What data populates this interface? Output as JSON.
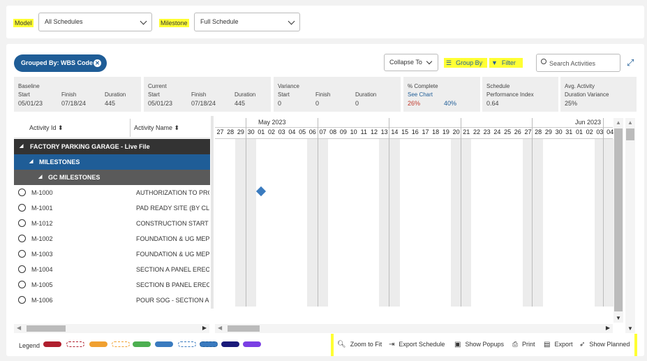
{
  "filters": {
    "model_label": "Model",
    "model_value": "All Schedules",
    "milestone_label": "Milestone",
    "milestone_value": "Full Schedule"
  },
  "toolbar": {
    "grouped_by": "Grouped By: WBS Code",
    "collapse_to": "Collapse To",
    "group_by": "Group By",
    "filter": "Filter",
    "search_placeholder": "Search Activities"
  },
  "stats": {
    "baseline": {
      "title": "Baseline",
      "start_label": "Start",
      "finish_label": "Finish",
      "duration_label": "Duration",
      "start": "05/01/23",
      "finish": "07/18/24",
      "duration": "445"
    },
    "current": {
      "title": "Current",
      "start_label": "Start",
      "finish_label": "Finish",
      "duration_label": "Duration",
      "start": "05/01/23",
      "finish": "07/18/24",
      "duration": "445"
    },
    "variance": {
      "title": "Variance",
      "start_label": "Start",
      "finish_label": "Finish",
      "duration_label": "Duration",
      "start": "0",
      "finish": "0",
      "duration": "0"
    },
    "pct_complete": {
      "title": "% Complete",
      "link": "See Chart",
      "actual": "26%",
      "planned": "40%"
    },
    "spi": {
      "title": "Schedule",
      "title2": "Performance Index",
      "value": "0.64"
    },
    "avg_duration": {
      "title": "Avg. Activity",
      "title2": "Duration Variance",
      "value": "25%"
    }
  },
  "grid": {
    "col_activity_id": "Activity Id",
    "col_activity_name": "Activity Name",
    "groups": [
      {
        "label": "FACTORY PARKING GARAGE - Live File"
      },
      {
        "label": "MILESTONES"
      },
      {
        "label": "GC MILESTONES"
      }
    ],
    "rows": [
      {
        "id": "M-1000",
        "name": "AUTHORIZATION TO PRO"
      },
      {
        "id": "M-1001",
        "name": "PAD READY SITE (BY CLIE"
      },
      {
        "id": "M-1012",
        "name": "CONSTRUCTION START"
      },
      {
        "id": "M-1002",
        "name": "FOUNDATION & UG MEP"
      },
      {
        "id": "M-1003",
        "name": "FOUNDATION & UG MEP"
      },
      {
        "id": "M-1004",
        "name": "SECTION A PANEL ERECTI"
      },
      {
        "id": "M-1005",
        "name": "SECTION B PANEL ERECTI"
      },
      {
        "id": "M-1006",
        "name": "POUR SOG - SECTION A C"
      }
    ]
  },
  "timeline": {
    "month1": "May 2023",
    "month2": "Jun 2023",
    "days": [
      "27",
      "28",
      "29",
      "30",
      "01",
      "02",
      "03",
      "04",
      "05",
      "06",
      "07",
      "08",
      "09",
      "10",
      "11",
      "12",
      "13",
      "14",
      "15",
      "16",
      "17",
      "18",
      "19",
      "20",
      "21",
      "22",
      "23",
      "24",
      "25",
      "26",
      "27",
      "28",
      "29",
      "30",
      "31",
      "01",
      "02",
      "03",
      "04"
    ]
  },
  "legend": {
    "label": "Legend",
    "colors": [
      "#b01f2e",
      "#ffffff",
      "#f0a030",
      "#ffffff",
      "#4caf50",
      "#3a7bbf",
      "#ffffff",
      "#3a7bbf",
      "#1a1a7a",
      "#7b3fe4"
    ]
  },
  "bottom_toolbar": {
    "zoom": "Zoom to Fit",
    "export_schedule": "Export Schedule",
    "show_popups": "Show Popups",
    "print": "Print",
    "export": "Export",
    "show_planned": "Show Planned"
  }
}
